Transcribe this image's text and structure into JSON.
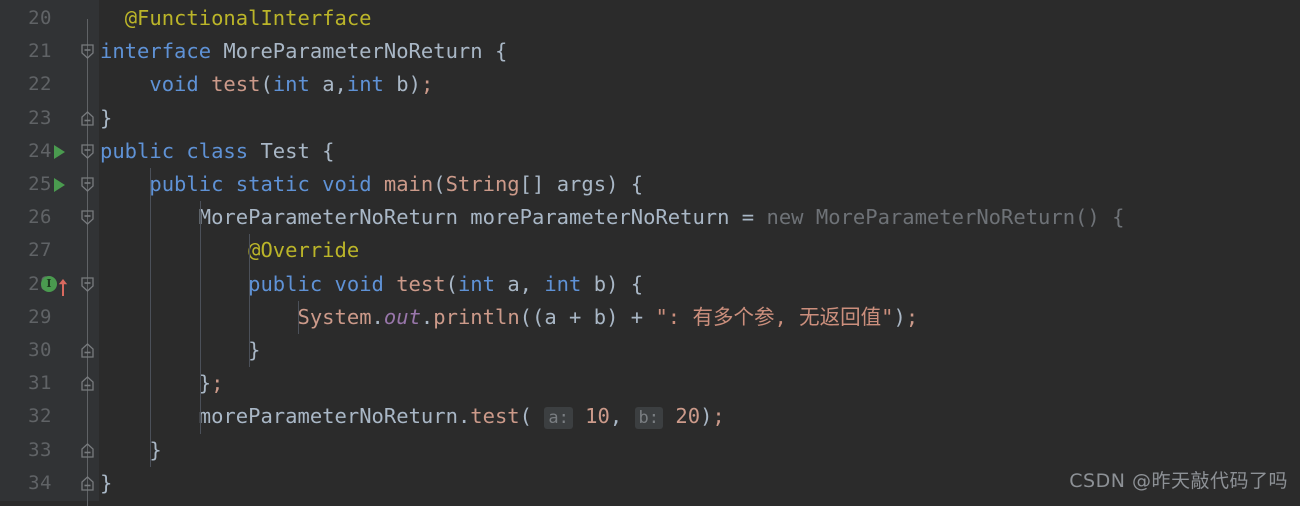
{
  "editor": {
    "theme_bg": "#2b2b2b",
    "gutter_bg": "#313335",
    "first_line": 20,
    "lines": [
      {
        "no": "20",
        "indent_guides": [],
        "fold": "none",
        "gutter_icon": "none",
        "change_marker": false,
        "tokens": [
          {
            "t": "  ",
            "c": "punct"
          },
          {
            "t": "@FunctionalInterface",
            "c": "anno"
          }
        ]
      },
      {
        "no": "21",
        "indent_guides": [],
        "fold": "start",
        "gutter_icon": "none",
        "change_marker": false,
        "tokens": [
          {
            "t": "interface ",
            "c": "kw"
          },
          {
            "t": "MoreParameterNoReturn",
            "c": "ident"
          },
          {
            "t": " {",
            "c": "punct"
          }
        ]
      },
      {
        "no": "22",
        "indent_guides": [],
        "fold": "none",
        "gutter_icon": "none",
        "change_marker": false,
        "tokens": [
          {
            "t": "    ",
            "c": "punct"
          },
          {
            "t": "void ",
            "c": "kw"
          },
          {
            "t": "test",
            "c": "fn"
          },
          {
            "t": "(",
            "c": "punct"
          },
          {
            "t": "int ",
            "c": "kw"
          },
          {
            "t": "a",
            "c": "ident"
          },
          {
            "t": ",",
            "c": "punct"
          },
          {
            "t": "int ",
            "c": "kw"
          },
          {
            "t": "b",
            "c": "ident"
          },
          {
            "t": ")",
            "c": "punct"
          },
          {
            "t": ";",
            "c": "semi"
          }
        ]
      },
      {
        "no": "23",
        "indent_guides": [],
        "fold": "end",
        "gutter_icon": "none",
        "change_marker": true,
        "tokens": [
          {
            "t": "}",
            "c": "punct"
          }
        ]
      },
      {
        "no": "24",
        "indent_guides": [],
        "fold": "start",
        "gutter_icon": "run",
        "change_marker": false,
        "tokens": [
          {
            "t": "public class ",
            "c": "kw"
          },
          {
            "t": "Test",
            "c": "ident"
          },
          {
            "t": " {",
            "c": "punct"
          }
        ]
      },
      {
        "no": "25",
        "indent_guides": [
          1
        ],
        "fold": "start",
        "gutter_icon": "run",
        "change_marker": false,
        "tokens": [
          {
            "t": "    ",
            "c": "punct"
          },
          {
            "t": "public static void ",
            "c": "kw"
          },
          {
            "t": "main",
            "c": "fn"
          },
          {
            "t": "(",
            "c": "punct"
          },
          {
            "t": "String",
            "c": "type"
          },
          {
            "t": "[] ",
            "c": "punct"
          },
          {
            "t": "args",
            "c": "ident"
          },
          {
            "t": ") {",
            "c": "punct"
          }
        ]
      },
      {
        "no": "26",
        "indent_guides": [
          1,
          2
        ],
        "fold": "start",
        "gutter_icon": "none",
        "change_marker": false,
        "tokens": [
          {
            "t": "        ",
            "c": "punct"
          },
          {
            "t": "MoreParameterNoReturn ",
            "c": "ident"
          },
          {
            "t": "moreParameterNoReturn",
            "c": "ident"
          },
          {
            "t": " = ",
            "c": "op"
          },
          {
            "t": "new ",
            "c": "dim"
          },
          {
            "t": "MoreParameterNoReturn() {",
            "c": "dim"
          }
        ]
      },
      {
        "no": "27",
        "indent_guides": [
          1,
          2,
          3
        ],
        "fold": "none",
        "gutter_icon": "none",
        "change_marker": false,
        "tokens": [
          {
            "t": "            ",
            "c": "punct"
          },
          {
            "t": "@Override",
            "c": "anno"
          }
        ]
      },
      {
        "no": "28",
        "indent_guides": [
          1,
          2,
          3
        ],
        "fold": "start",
        "gutter_icon": "implements",
        "change_marker": false,
        "tokens": [
          {
            "t": "            ",
            "c": "punct"
          },
          {
            "t": "public void ",
            "c": "kw"
          },
          {
            "t": "test",
            "c": "fn"
          },
          {
            "t": "(",
            "c": "punct"
          },
          {
            "t": "int ",
            "c": "kw"
          },
          {
            "t": "a",
            "c": "ident"
          },
          {
            "t": ", ",
            "c": "punct"
          },
          {
            "t": "int ",
            "c": "kw"
          },
          {
            "t": "b",
            "c": "ident"
          },
          {
            "t": ") {",
            "c": "punct"
          }
        ]
      },
      {
        "no": "29",
        "indent_guides": [
          1,
          2,
          3,
          4
        ],
        "fold": "none",
        "gutter_icon": "none",
        "change_marker": false,
        "tokens": [
          {
            "t": "                ",
            "c": "punct"
          },
          {
            "t": "System",
            "c": "type"
          },
          {
            "t": ".",
            "c": "punct"
          },
          {
            "t": "out",
            "c": "field-italic"
          },
          {
            "t": ".",
            "c": "punct"
          },
          {
            "t": "println",
            "c": "fn"
          },
          {
            "t": "((",
            "c": "punct"
          },
          {
            "t": "a",
            "c": "ident"
          },
          {
            "t": " + ",
            "c": "op"
          },
          {
            "t": "b",
            "c": "ident"
          },
          {
            "t": ")",
            "c": "punct"
          },
          {
            "t": " + ",
            "c": "op"
          },
          {
            "t": "\": 有多个参, 无返回值\"",
            "c": "str"
          },
          {
            "t": ")",
            "c": "punct"
          },
          {
            "t": ";",
            "c": "semi"
          }
        ]
      },
      {
        "no": "30",
        "indent_guides": [
          1,
          2,
          3
        ],
        "fold": "end",
        "gutter_icon": "none",
        "change_marker": false,
        "tokens": [
          {
            "t": "            ",
            "c": "punct"
          },
          {
            "t": "}",
            "c": "punct"
          }
        ]
      },
      {
        "no": "31",
        "indent_guides": [
          1,
          2
        ],
        "fold": "end",
        "gutter_icon": "none",
        "change_marker": false,
        "tokens": [
          {
            "t": "        ",
            "c": "punct"
          },
          {
            "t": "}",
            "c": "punct"
          },
          {
            "t": ";",
            "c": "semi"
          }
        ]
      },
      {
        "no": "32",
        "indent_guides": [
          1,
          2
        ],
        "fold": "none",
        "gutter_icon": "none",
        "change_marker": false,
        "tokens": [
          {
            "t": "        ",
            "c": "punct"
          },
          {
            "t": "moreParameterNoReturn",
            "c": "ident"
          },
          {
            "t": ".",
            "c": "punct"
          },
          {
            "t": "test",
            "c": "fn"
          },
          {
            "t": "(",
            "c": "punct"
          },
          {
            "t": " ",
            "c": "punct"
          },
          {
            "t": "a:",
            "c": "param-hint"
          },
          {
            "t": " ",
            "c": "punct"
          },
          {
            "t": "10",
            "c": "num"
          },
          {
            "t": ", ",
            "c": "punct"
          },
          {
            "t": "b:",
            "c": "param-hint"
          },
          {
            "t": " ",
            "c": "punct"
          },
          {
            "t": "20",
            "c": "num"
          },
          {
            "t": ")",
            "c": "punct"
          },
          {
            "t": ";",
            "c": "semi"
          }
        ]
      },
      {
        "no": "33",
        "indent_guides": [
          1
        ],
        "fold": "end",
        "gutter_icon": "none",
        "change_marker": false,
        "tokens": [
          {
            "t": "    ",
            "c": "punct"
          },
          {
            "t": "}",
            "c": "punct"
          }
        ]
      },
      {
        "no": "34",
        "indent_guides": [],
        "fold": "end",
        "gutter_icon": "none",
        "change_marker": false,
        "tokens": [
          {
            "t": "}",
            "c": "punct"
          }
        ]
      }
    ]
  },
  "watermark": {
    "text": "CSDN @昨天敲代码了吗"
  },
  "icons": {
    "run": "run-triangle-icon",
    "implements": "implementing-method-icon",
    "fold_start": "fold-collapse-start-icon",
    "fold_end": "fold-collapse-end-icon"
  },
  "colors": {
    "background": "#2b2b2b",
    "gutter": "#313335",
    "line_number": "#606366",
    "keyword": "#5f92d6",
    "identifier": "#a9b7c6",
    "string": "#cc8f7d",
    "annotation": "#bbb529",
    "number": "#cc9a8a",
    "dimmed": "#6e7277",
    "field_italic": "#9876aa",
    "run_icon_green": "#4a9b4f",
    "change_marker_blue": "#1b3a55",
    "indent_guide": "#4b5059"
  }
}
